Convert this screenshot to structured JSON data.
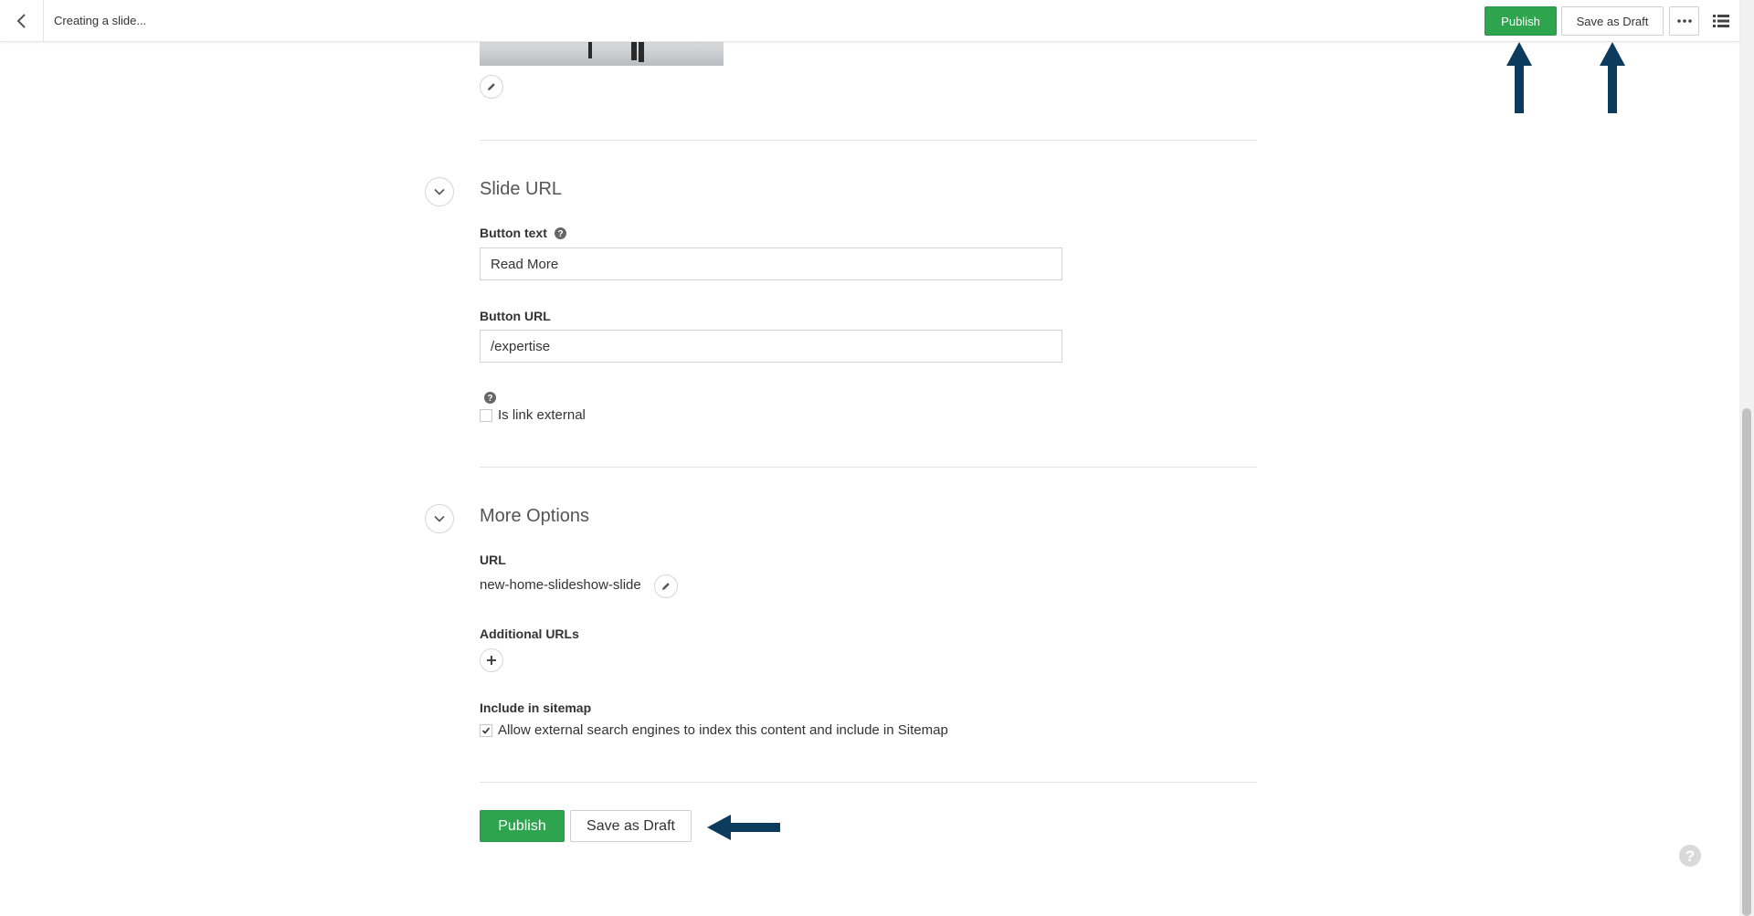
{
  "header": {
    "title": "Creating a slide...",
    "publish_label": "Publish",
    "save_draft_label": "Save as Draft"
  },
  "slide_url_section": {
    "title": "Slide URL",
    "button_text_label": "Button text",
    "button_text_value": "Read More",
    "button_url_label": "Button URL",
    "button_url_value": "/expertise",
    "is_link_external_label": "Is link external",
    "is_link_external_checked": false
  },
  "more_options_section": {
    "title": "More Options",
    "url_label": "URL",
    "url_value": "new-home-slideshow-slide",
    "additional_urls_label": "Additional URLs",
    "include_in_sitemap_label": "Include in sitemap",
    "sitemap_checkbox_label": "Allow external search engines to index this content and include in Sitemap",
    "sitemap_checked": true
  },
  "footer_actions": {
    "publish_label": "Publish",
    "save_draft_label": "Save as Draft"
  },
  "colors": {
    "publish_green": "#2ea44f",
    "annotation_arrow": "#0c3b5e"
  },
  "icons": {
    "back": "chevron-left-icon",
    "more": "ellipsis-icon",
    "list": "list-icon",
    "edit": "pencil-icon",
    "collapse": "chevron-down-icon",
    "help": "question-circle-icon",
    "add": "plus-icon"
  }
}
